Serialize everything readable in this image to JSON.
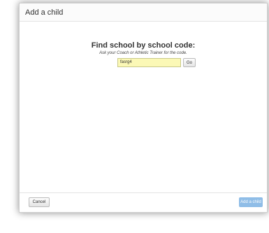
{
  "dialog": {
    "title": "Add a child"
  },
  "find_school": {
    "heading": "Find school by school code:",
    "help_text": "Ask your Coach or Athletic Trainer for the code.",
    "code_value": "fasrg4",
    "go_label": "Go"
  },
  "footer": {
    "cancel_label": "Cancel",
    "add_child_label": "Add a child"
  },
  "colors": {
    "input_background": "#fbf8b6",
    "primary_button_disabled": "#8fbde7"
  }
}
